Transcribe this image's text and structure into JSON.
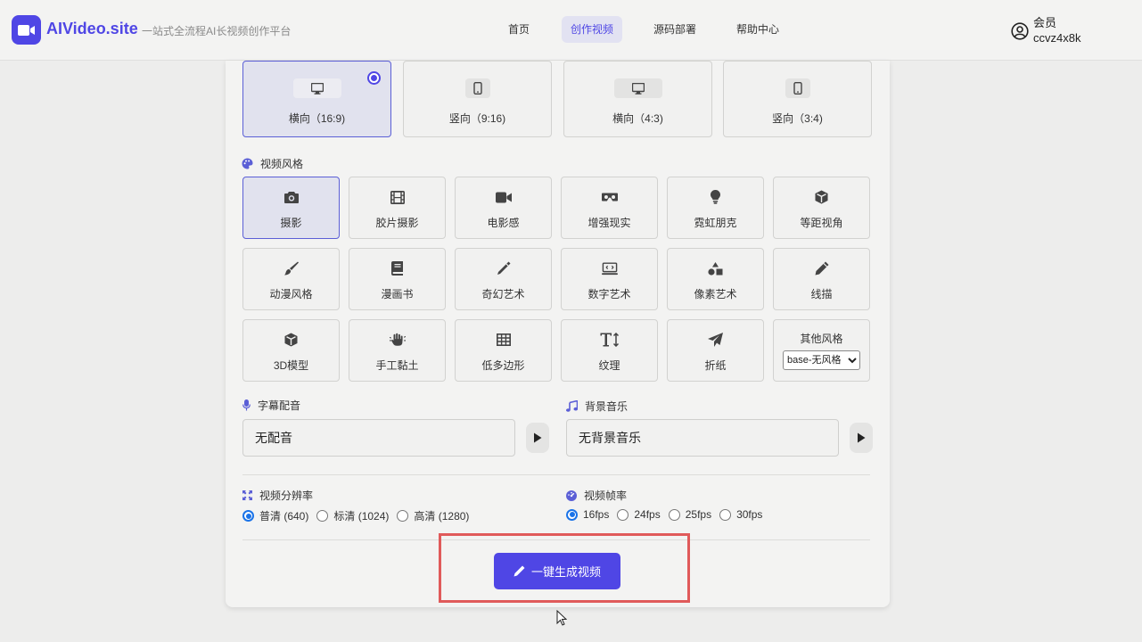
{
  "header": {
    "brand": "AIVideo.site",
    "tagline": "一站式全流程AI长视频创作平台",
    "nav": [
      {
        "label": "首页",
        "active": false
      },
      {
        "label": "创作视频",
        "active": true
      },
      {
        "label": "源码部署",
        "active": false
      },
      {
        "label": "帮助中心",
        "active": false
      }
    ],
    "user": {
      "role": "会员",
      "name": "ccvz4x8k"
    }
  },
  "aspect_ratios": {
    "selected_index": 0,
    "items": [
      {
        "label": "横向（16:9)",
        "icon": "desktop-icon"
      },
      {
        "label": "竖向（9:16)",
        "icon": "mobile-icon"
      },
      {
        "label": "横向（4:3)",
        "icon": "desktop-icon"
      },
      {
        "label": "竖向（3:4)",
        "icon": "mobile-icon"
      }
    ]
  },
  "style_section": {
    "title": "视频风格",
    "selected_index": 0,
    "items": [
      {
        "label": "摄影",
        "icon": "camera-icon"
      },
      {
        "label": "胶片摄影",
        "icon": "film-icon"
      },
      {
        "label": "电影感",
        "icon": "video-camera-icon"
      },
      {
        "label": "增强现实",
        "icon": "vr-headset-icon"
      },
      {
        "label": "霓虹朋克",
        "icon": "lightbulb-icon"
      },
      {
        "label": "等距视角",
        "icon": "cube-icon"
      },
      {
        "label": "动漫风格",
        "icon": "paintbrush-icon"
      },
      {
        "label": "漫画书",
        "icon": "book-icon"
      },
      {
        "label": "奇幻艺术",
        "icon": "magic-wand-icon"
      },
      {
        "label": "数字艺术",
        "icon": "digital-screen-icon"
      },
      {
        "label": "像素艺术",
        "icon": "shapes-icon"
      },
      {
        "label": "线描",
        "icon": "pencil-icon"
      },
      {
        "label": "3D模型",
        "icon": "cube-icon"
      },
      {
        "label": "手工黏土",
        "icon": "hand-icon"
      },
      {
        "label": "低多边形",
        "icon": "grid-icon"
      },
      {
        "label": "纹理",
        "icon": "text-height-icon"
      },
      {
        "label": "折纸",
        "icon": "paper-plane-icon"
      }
    ],
    "other": {
      "label": "其他风格",
      "selected": "base-无风格"
    }
  },
  "audio": {
    "voice": {
      "title": "字幕配音",
      "value": "无配音"
    },
    "music": {
      "title": "背景音乐",
      "value": "无背景音乐"
    }
  },
  "resolution": {
    "title": "视频分辨率",
    "options": [
      {
        "label": "普清 (640)",
        "checked": true
      },
      {
        "label": "标清 (1024)",
        "checked": false
      },
      {
        "label": "高清 (1280)",
        "checked": false
      }
    ]
  },
  "framerate": {
    "title": "视频帧率",
    "options": [
      {
        "label": "16fps",
        "checked": true
      },
      {
        "label": "24fps",
        "checked": false
      },
      {
        "label": "25fps",
        "checked": false
      },
      {
        "label": "30fps",
        "checked": false
      }
    ]
  },
  "generate_button": {
    "label": "一键生成视频"
  },
  "colors": {
    "accent": "#4f46e5",
    "highlight_border": "#e05a5a",
    "radio_blue": "#1a73e8"
  }
}
